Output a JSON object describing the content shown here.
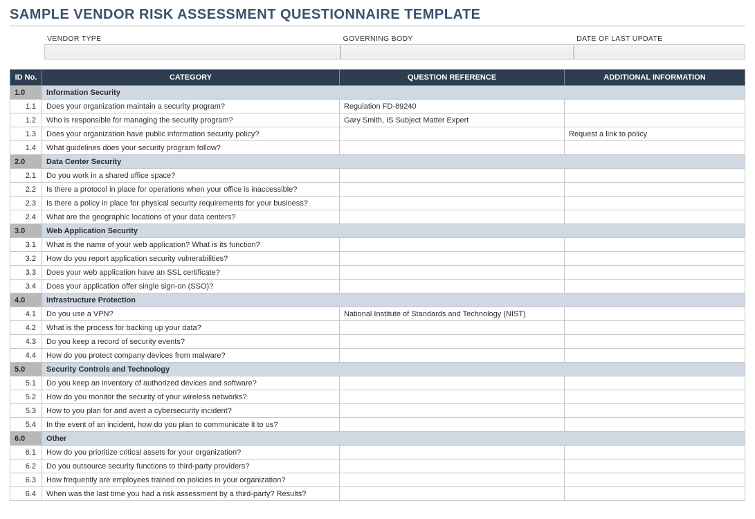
{
  "title": "SAMPLE VENDOR RISK ASSESSMENT QUESTIONNAIRE TEMPLATE",
  "meta": {
    "vendor_type_label": "VENDOR TYPE",
    "vendor_type_value": "",
    "governing_body_label": "GOVERNING BODY",
    "governing_body_value": "",
    "date_label": "DATE OF LAST UPDATE",
    "date_value": ""
  },
  "columns": {
    "id": "ID No.",
    "category": "CATEGORY",
    "reference": "QUESTION REFERENCE",
    "additional": "ADDITIONAL INFORMATION"
  },
  "rows": [
    {
      "type": "section",
      "id": "1.0",
      "category": "Information Security"
    },
    {
      "type": "data",
      "id": "1.1",
      "category": "Does your organization maintain a security program?",
      "reference": "Regulation FD-89240",
      "additional": ""
    },
    {
      "type": "data",
      "id": "1.2",
      "category": "Who is responsible for managing the security program?",
      "reference": "Gary Smith, IS Subject Matter Expert",
      "additional": ""
    },
    {
      "type": "data",
      "id": "1.3",
      "category": "Does your organization have public information security policy?",
      "reference": "",
      "additional": "Request a link to policy"
    },
    {
      "type": "data",
      "id": "1.4",
      "category": "What guidelines does your security program follow?",
      "reference": "",
      "additional": ""
    },
    {
      "type": "section",
      "id": "2.0",
      "category": "Data Center Security"
    },
    {
      "type": "data",
      "id": "2.1",
      "category": "Do you work in a shared office space?",
      "reference": "",
      "additional": ""
    },
    {
      "type": "data",
      "id": "2.2",
      "category": "Is there a protocol in place for operations when your office is inaccessible?",
      "reference": "",
      "additional": ""
    },
    {
      "type": "data",
      "id": "2.3",
      "category": "Is there a policy in place for physical security requirements for your business?",
      "reference": "",
      "additional": ""
    },
    {
      "type": "data",
      "id": "2.4",
      "category": "What are the geographic locations of your data centers?",
      "reference": "",
      "additional": ""
    },
    {
      "type": "section",
      "id": "3.0",
      "category": "Web Application Security"
    },
    {
      "type": "data",
      "id": "3.1",
      "category": "What is the name of your web application? What is its function?",
      "reference": "",
      "additional": ""
    },
    {
      "type": "data",
      "id": "3.2",
      "category": "How do you report application security vulnerabilities?",
      "reference": "",
      "additional": ""
    },
    {
      "type": "data",
      "id": "3.3",
      "category": "Does your web application have an SSL certificate?",
      "reference": "",
      "additional": ""
    },
    {
      "type": "data",
      "id": "3.4",
      "category": "Does your application offer single sign-on (SSO)?",
      "reference": "",
      "additional": ""
    },
    {
      "type": "section",
      "id": "4.0",
      "category": "Infrastructure Protection"
    },
    {
      "type": "data",
      "id": "4.1",
      "category": "Do you use a VPN?",
      "reference": "National Institute of Standards and Technology (NIST)",
      "additional": ""
    },
    {
      "type": "data",
      "id": "4.2",
      "category": "What is the process for backing up your data?",
      "reference": "",
      "additional": ""
    },
    {
      "type": "data",
      "id": "4.3",
      "category": "Do you keep a record of security events?",
      "reference": "",
      "additional": ""
    },
    {
      "type": "data",
      "id": "4.4",
      "category": "How do you protect company devices from malware?",
      "reference": "",
      "additional": ""
    },
    {
      "type": "section",
      "id": "5.0",
      "category": "Security Controls and Technology"
    },
    {
      "type": "data",
      "id": "5.1",
      "category": "Do you keep an inventory of authorized devices and software?",
      "reference": "",
      "additional": ""
    },
    {
      "type": "data",
      "id": "5.2",
      "category": "How do you monitor the security of your wireless networks?",
      "reference": "",
      "additional": ""
    },
    {
      "type": "data",
      "id": "5.3",
      "category": "How to you plan for and avert a cybersecurity incident?",
      "reference": "",
      "additional": ""
    },
    {
      "type": "data",
      "id": "5.4",
      "category": "In the event of an incident, how do you plan to communicate it to us?",
      "reference": "",
      "additional": ""
    },
    {
      "type": "section",
      "id": "6.0",
      "category": "Other"
    },
    {
      "type": "data",
      "id": "6.1",
      "category": "How do you prioritize critical assets for your organization?",
      "reference": "",
      "additional": ""
    },
    {
      "type": "data",
      "id": "6.2",
      "category": "Do you outsource security functions to third-party providers?",
      "reference": "",
      "additional": ""
    },
    {
      "type": "data",
      "id": "6.3",
      "category": "How frequently are employees trained on policies in your organization?",
      "reference": "",
      "additional": ""
    },
    {
      "type": "data",
      "id": "6.4",
      "category": "When was the last time you had a risk assessment by a third-party? Results?",
      "reference": "",
      "additional": ""
    }
  ]
}
